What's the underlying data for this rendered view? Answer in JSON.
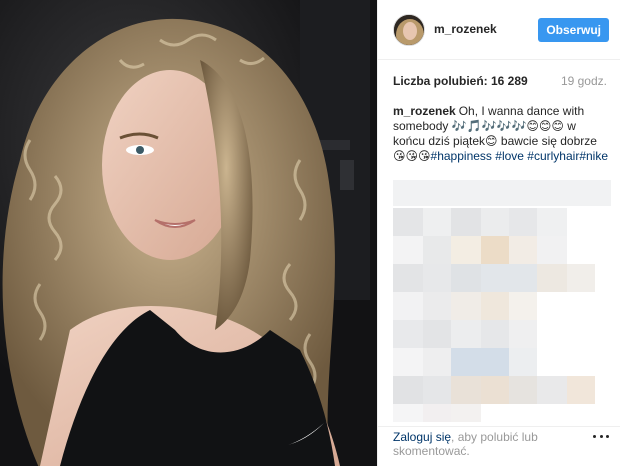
{
  "post": {
    "username": "m_rozenek",
    "follow_label": "Obserwuj",
    "likes_label": "Liczba polubień: 16 289",
    "time_ago": "19 godz.",
    "caption": {
      "username": "m_rozenek",
      "text": "Oh, I wanna dance with somebody 🎶🎵🎶🎶🎶😊😊😊 w końcu dziś piątek😊 bawcie się dobrze 😘😘😘",
      "hashtags": [
        "#happiness",
        "#love",
        "#curlyhair",
        "#nike"
      ]
    },
    "footer": {
      "login_link": "Zaloguj się",
      "rest": ", aby polubić lub skomentować."
    },
    "icons": {
      "more": "more-options-icon",
      "avatar": "avatar-image",
      "photo_logo": "nike-swoosh-logo"
    },
    "colors": {
      "follow_button": "#3897f0",
      "hashtag": "#003569",
      "muted": "#999999"
    }
  }
}
